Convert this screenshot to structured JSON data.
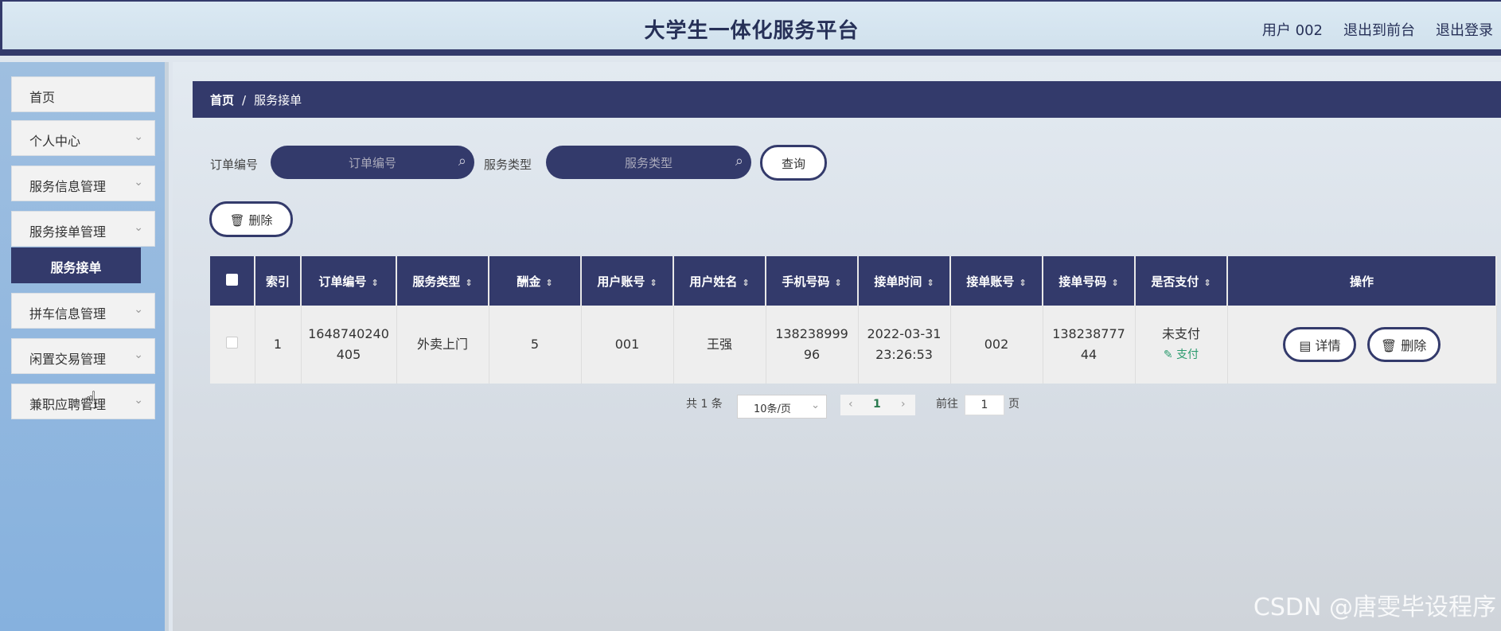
{
  "header": {
    "title": "大学生一体化服务平台",
    "user": "用户 002",
    "to_front": "退出到前台",
    "logout": "退出登录"
  },
  "sidebar": {
    "items": [
      {
        "label": "首页",
        "has_chevron": false
      },
      {
        "label": "个人中心",
        "has_chevron": true
      },
      {
        "label": "服务信息管理",
        "has_chevron": true
      },
      {
        "label": "服务接单管理",
        "has_chevron": true
      },
      {
        "label": "拼车信息管理",
        "has_chevron": true
      },
      {
        "label": "闲置交易管理",
        "has_chevron": true
      },
      {
        "label": "兼职应聘管理",
        "has_chevron": true
      }
    ],
    "active_sub": "服务接单"
  },
  "breadcrumb": {
    "home": "首页",
    "sep": "/",
    "current": "服务接单"
  },
  "filters": {
    "order_label": "订单编号",
    "order_placeholder": "订单编号",
    "type_label": "服务类型",
    "type_placeholder": "服务类型",
    "query_button": "查询",
    "delete_button": "删除"
  },
  "table": {
    "headers": [
      "索引",
      "订单编号",
      "服务类型",
      "酬金",
      "用户账号",
      "用户姓名",
      "手机号码",
      "接单时间",
      "接单账号",
      "接单号码",
      "是否支付",
      "操作"
    ],
    "rows": [
      {
        "index": "1",
        "order_no": [
          "1648740240",
          "405"
        ],
        "service_type": "外卖上门",
        "reward": "5",
        "user_account": "001",
        "user_name": "王强",
        "phone": [
          "138238999",
          "96"
        ],
        "time": [
          "2022-03-31",
          "23:26:53"
        ],
        "taker_account": "002",
        "taker_phone": [
          "138238777",
          "44"
        ],
        "paid": "未支付",
        "pay_action": "支付",
        "detail_button": "详情",
        "delete_button": "删除"
      }
    ]
  },
  "pagination": {
    "total": "共 1 条",
    "page_size": "10条/页",
    "current_page": "1",
    "goto_label": "前往",
    "goto_value": "1",
    "goto_suffix": "页"
  },
  "watermark": "CSDN @唐雯毕设程序"
}
